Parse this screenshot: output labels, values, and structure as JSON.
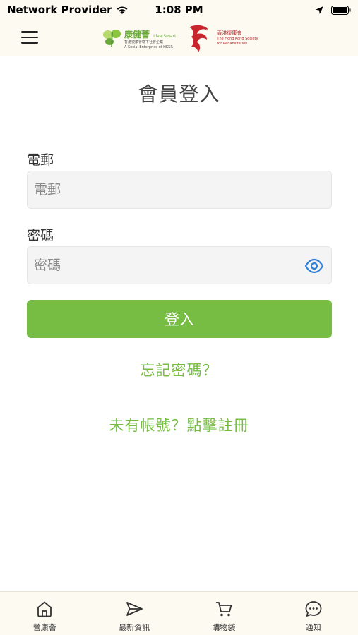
{
  "status_bar": {
    "carrier": "Network Provider",
    "time": "1:08 PM"
  },
  "header": {
    "logo_livesmart": {
      "brand": "康健薈",
      "brand_en": "Live Smart",
      "line1": "香港復康會轄下社會企業",
      "line2": "A Social Enterprise of HKSR"
    },
    "logo_hksr": {
      "zh": "香港復康會",
      "en1": "The Hong Kong Society",
      "en2": "for Rehabilitation"
    }
  },
  "page": {
    "title": "會員登入",
    "email_label": "電郵",
    "email_placeholder": "電郵",
    "email_value": "",
    "password_label": "密碼",
    "password_placeholder": "密碼",
    "password_value": "",
    "login_button": "登入",
    "forgot_password": "忘記密碼？",
    "register_link": "未有帳號？點擊註冊"
  },
  "tabbar": {
    "items": [
      {
        "label": "營康薈",
        "icon": "home-icon"
      },
      {
        "label": "最新資訊",
        "icon": "send-icon"
      },
      {
        "label": "購物袋",
        "icon": "cart-icon"
      },
      {
        "label": "通知",
        "icon": "chat-icon"
      }
    ]
  },
  "colors": {
    "accent_green": "#77bd44",
    "eye_blue": "#2f7fd8",
    "header_bg": "#fdfaf2"
  }
}
